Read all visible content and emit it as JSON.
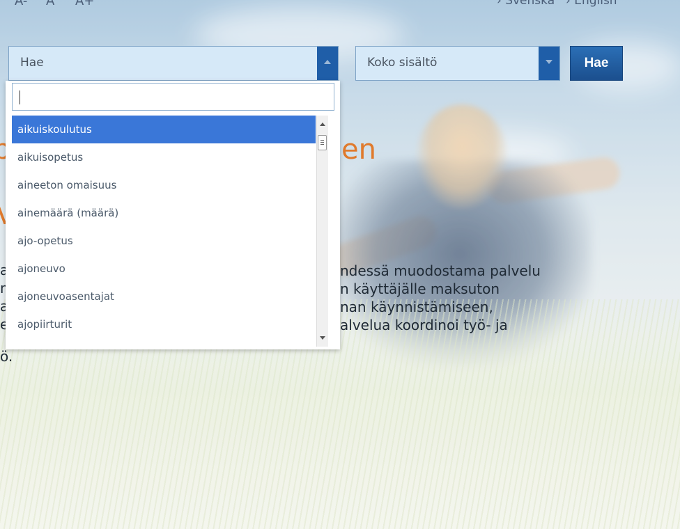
{
  "font_size_controls": [
    "A-",
    "A",
    "A+"
  ],
  "language_links": [
    "› Svenska",
    "› English"
  ],
  "search": {
    "label": "Hae",
    "scope_label": "Koko sisältö",
    "submit_label": "Hae",
    "input_value": ""
  },
  "dropdown": {
    "items": [
      "aikuiskoulutus",
      "aikuisopetus",
      "aineeton omaisuus",
      "ainemäärä (määrä)",
      "ajo-opetus",
      "ajoneuvo",
      "ajoneuvoasentajat",
      "ajopiirturit"
    ],
    "selected_index": 0
  },
  "page": {
    "headline_fragment_left": "p",
    "headline_fragment_right": "en",
    "headline2_fragment": "V",
    "paragraph_lines": [
      "ndessä muodostama palvelu",
      "n käyttäjälle maksuton",
      "nan käynnistämiseen,",
      "alvelua koordinoi työ- ja"
    ],
    "left_fragments": [
      "a",
      "m",
      "a",
      "e",
      "ö."
    ]
  },
  "colors": {
    "accent_blue": "#1f5ea8",
    "selected_item": "#3a77d8",
    "headline_orange": "#e07a2c"
  }
}
